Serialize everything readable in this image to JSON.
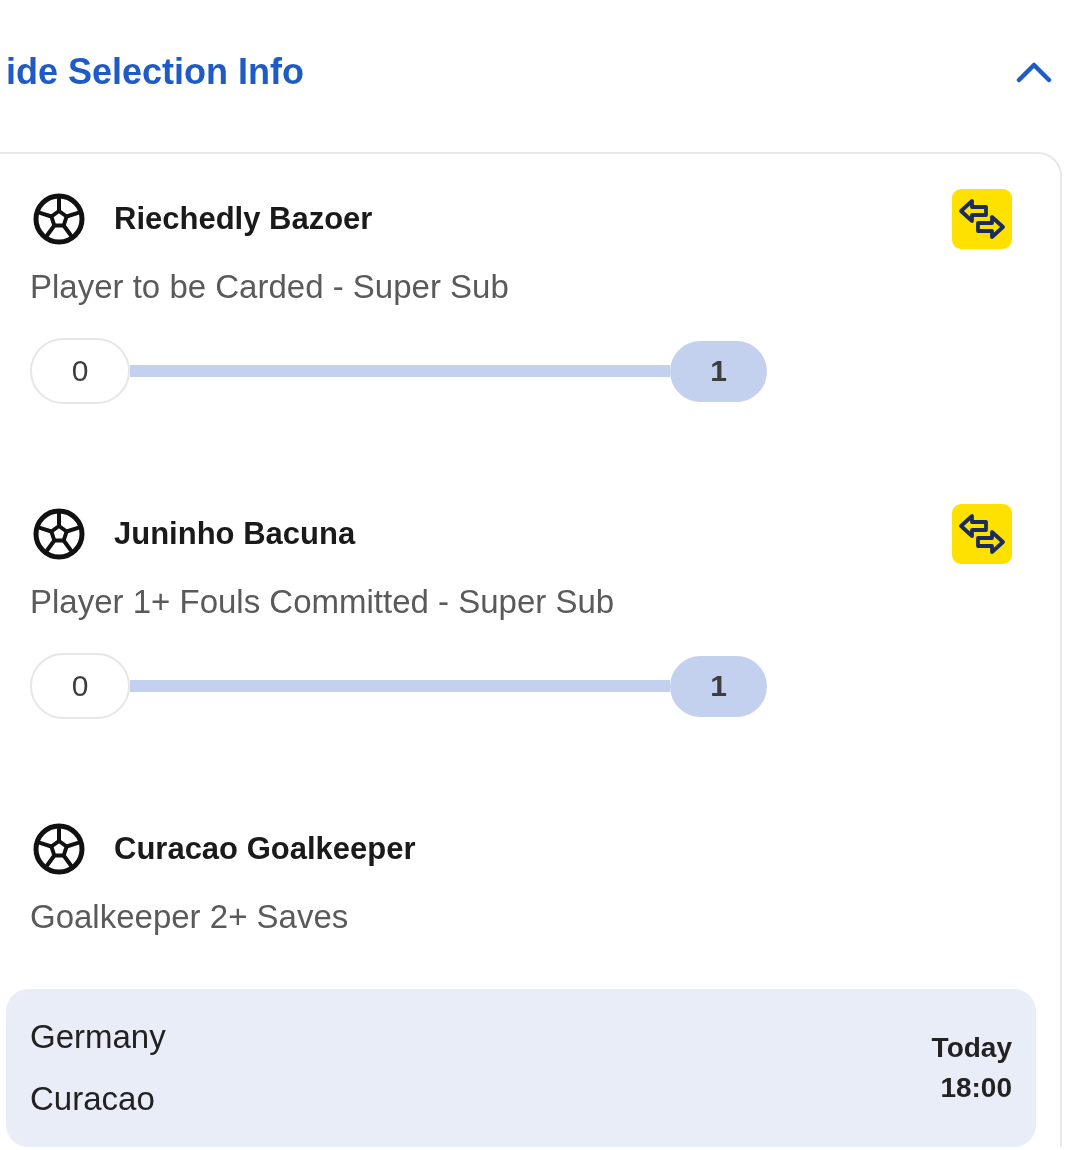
{
  "header": {
    "title": "ide Selection Info",
    "expanded": true
  },
  "selections": [
    {
      "name": "Riechedly Bazoer",
      "market": "Player to be Carded - Super Sub",
      "swappable": true,
      "progress": {
        "start": "0",
        "end": "1",
        "level": 1
      }
    },
    {
      "name": "Juninho Bacuna",
      "market": "Player 1+ Fouls Committed - Super Sub",
      "swappable": true,
      "progress": {
        "start": "0",
        "end": "1",
        "level": 1
      }
    },
    {
      "name": "Curacao Goalkeeper",
      "market": "Goalkeeper 2+ Saves",
      "swappable": false
    }
  ],
  "event": {
    "teams": [
      "Germany",
      "Curacao"
    ],
    "day": "Today",
    "time": "18:00"
  }
}
